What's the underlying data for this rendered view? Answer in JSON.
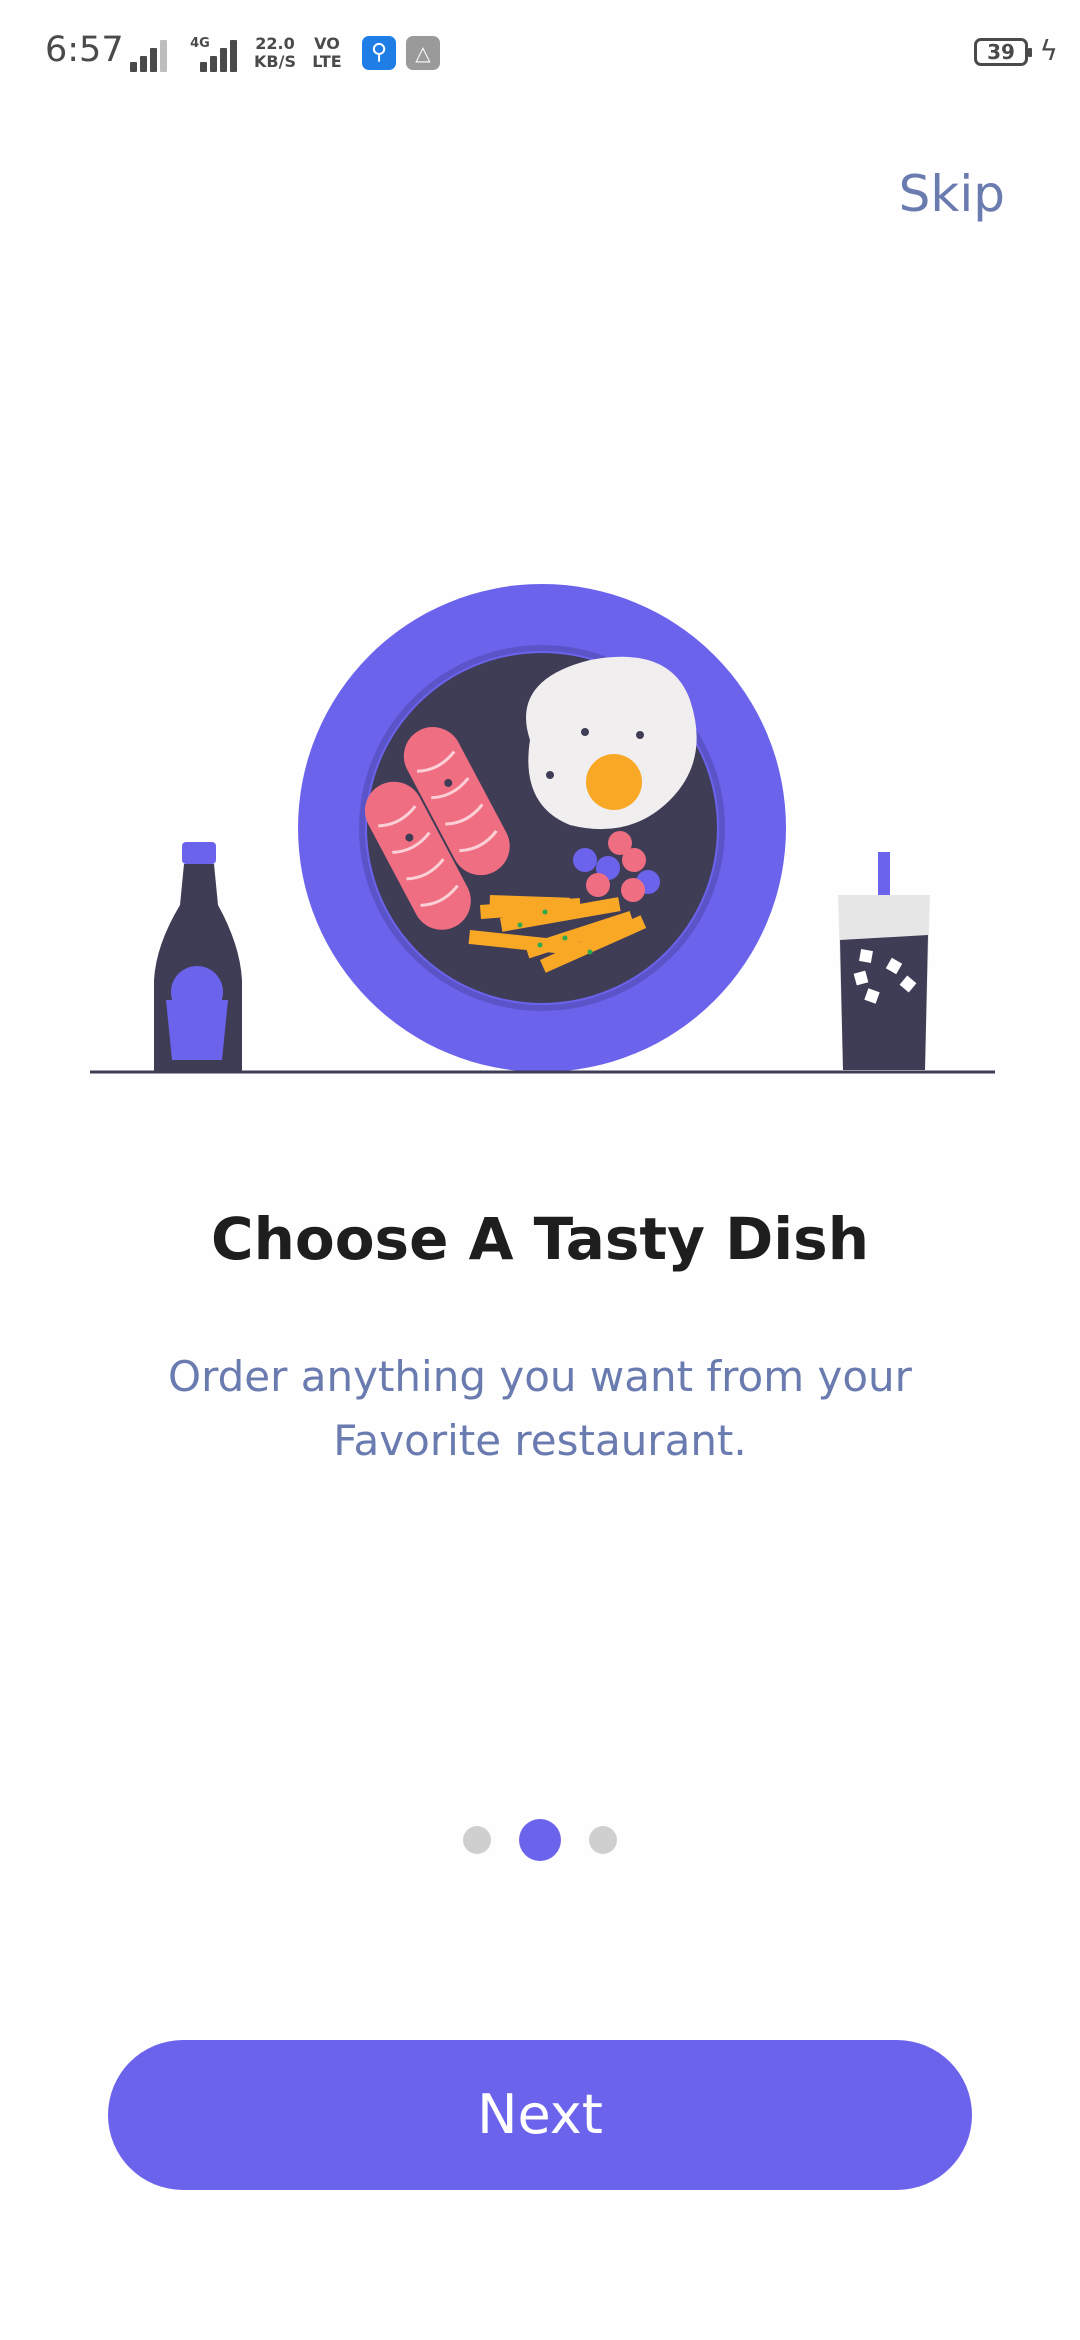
{
  "status_bar": {
    "time": "6:57",
    "network_speed_value": "22.0",
    "network_speed_unit": "KB/S",
    "net_type": "4G",
    "volte_top": "VO",
    "volte_bottom": "LTE",
    "battery_level": "39"
  },
  "onboarding": {
    "skip_label": "Skip",
    "title": "Choose A Tasty Dish",
    "subtitle_line1": "Order anything you want from your",
    "subtitle_line2": "Favorite restaurant.",
    "page_count": 3,
    "active_page": 2,
    "next_label": "Next"
  },
  "colors": {
    "accent": "#6C63ED",
    "dark": "#3F3D56",
    "muted_text": "#6A7BB0",
    "sausage": "#F06E82",
    "fries": "#F9A826",
    "yolk": "#F9A826"
  },
  "icons": [
    "signal-icon",
    "usb-icon",
    "sync-icon",
    "battery-icon",
    "charging-bolt-icon"
  ]
}
